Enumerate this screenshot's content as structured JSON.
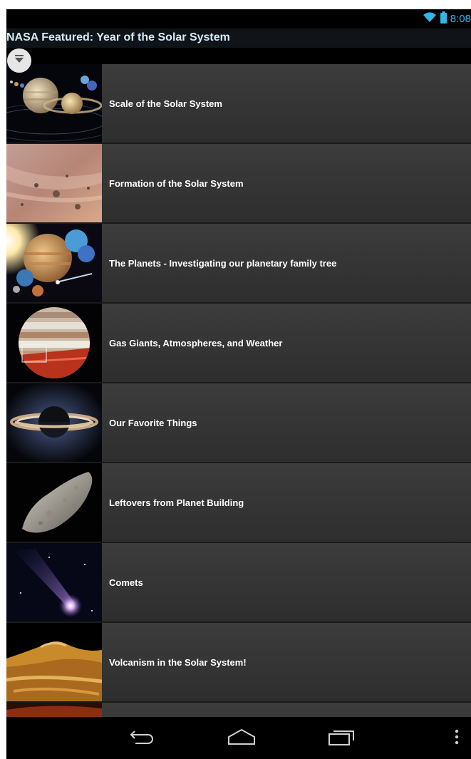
{
  "status_bar": {
    "time": "8:08",
    "wifi_icon": "wifi-icon",
    "battery_icon": "battery-icon"
  },
  "header": {
    "title": "NASA Featured: Year of the Solar System"
  },
  "filter_button_icon": "filter-down-icon",
  "items": [
    {
      "label": "Scale of the Solar System",
      "thumb": "planets-scale"
    },
    {
      "label": "Formation of the Solar System",
      "thumb": "formation"
    },
    {
      "label": "The Planets - Investigating our planetary family tree",
      "thumb": "planets-family"
    },
    {
      "label": "Gas Giants, Atmospheres, and Weather",
      "thumb": "gas-giant"
    },
    {
      "label": "Our Favorite Things",
      "thumb": "ringed-planet"
    },
    {
      "label": "Leftovers from Planet Building",
      "thumb": "asteroid"
    },
    {
      "label": "Comets",
      "thumb": "comet"
    },
    {
      "label": "Volcanism in the Solar System!",
      "thumb": "volcanic-surface"
    }
  ],
  "nav_bar": {
    "back_icon": "back-icon",
    "home_icon": "home-icon",
    "recents_icon": "recent-apps-icon",
    "menu_icon": "overflow-menu-icon"
  },
  "colors": {
    "status_accent": "#33b5e5",
    "title_text": "#d6ebf7",
    "list_bg": "#353535",
    "item_text": "#ffffff"
  }
}
